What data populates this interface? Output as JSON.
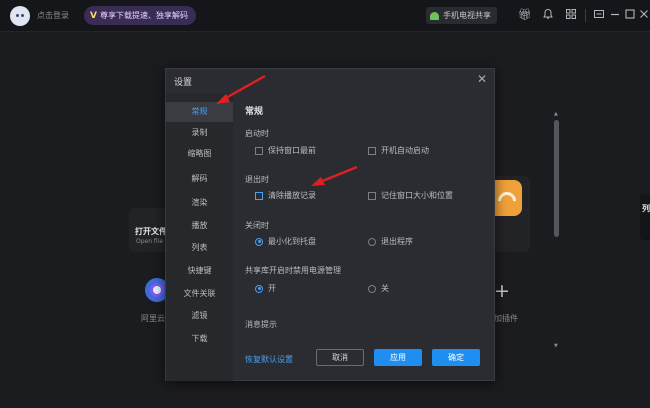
{
  "topbar": {
    "login_text": "点击登录",
    "vip_badge": "V",
    "vip_text": "尊享下载提速、独享解码",
    "share_text": "手机电视共享",
    "icons": [
      "gift-icon",
      "bell-icon",
      "grid-icon",
      "minimize-mode-icon",
      "minimize-icon",
      "maximize-icon",
      "close-icon"
    ]
  },
  "background": {
    "open_file_title": "打开文件",
    "open_file_sub": "Open file",
    "aliyun_label": "阿里云",
    "plugin_label": "加插件",
    "edge_label": "列"
  },
  "dialog": {
    "title": "设置",
    "nav": [
      "常规",
      "录制",
      "缩略图",
      "解码",
      "渲染",
      "播放",
      "列表",
      "快捷键",
      "文件关联",
      "滤镜",
      "下载"
    ],
    "active_nav": "常规",
    "section_title": "常规",
    "groups": {
      "startup": {
        "label": "启动时",
        "options": [
          {
            "label": "保持窗口最前",
            "checked": false
          },
          {
            "label": "开机自动启动",
            "checked": false
          }
        ]
      },
      "exit": {
        "label": "退出时",
        "options": [
          {
            "label": "清除播放记录",
            "checked": false
          },
          {
            "label": "记住窗口大小和位置",
            "checked": false
          }
        ]
      },
      "close": {
        "label": "关闭时",
        "options": [
          {
            "label": "最小化到托盘",
            "selected": true
          },
          {
            "label": "退出程序",
            "selected": false
          }
        ]
      },
      "power": {
        "label": "共享库开启时禁用电源管理",
        "options": [
          {
            "label": "开",
            "selected": true
          },
          {
            "label": "关",
            "selected": false
          }
        ]
      },
      "notice": {
        "label": "消息提示"
      }
    },
    "restore_link": "恢复默认设置",
    "buttons": {
      "cancel": "取消",
      "apply": "应用",
      "ok": "确定"
    }
  },
  "colors": {
    "accent": "#1e8ef0",
    "link": "#4aa0f2",
    "annotation_arrow": "#e02020"
  }
}
